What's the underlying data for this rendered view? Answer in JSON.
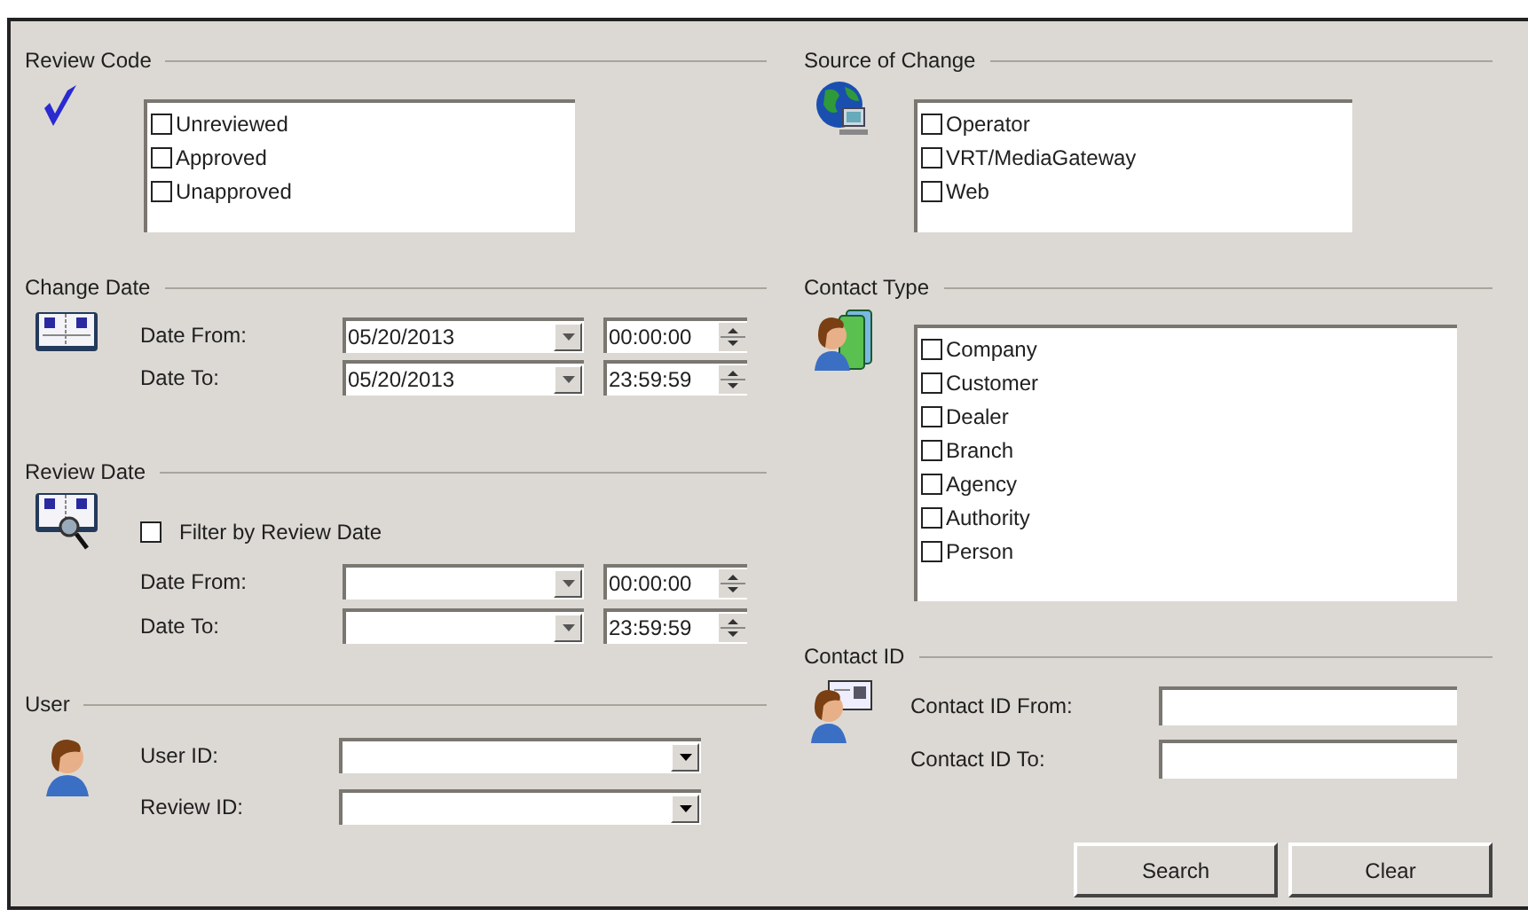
{
  "review_code": {
    "title": "Review Code",
    "options": [
      {
        "label": "Unreviewed",
        "checked": false
      },
      {
        "label": "Approved",
        "checked": false
      },
      {
        "label": "Unapproved",
        "checked": false
      }
    ]
  },
  "change_date": {
    "title": "Change Date",
    "rows": [
      {
        "label": "Date From:",
        "date": "05/20/2013",
        "time": "00:00:00"
      },
      {
        "label": "Date To:",
        "date": "05/20/2013",
        "time": "23:59:59"
      }
    ]
  },
  "review_date": {
    "title": "Review Date",
    "filter": {
      "label": "Filter by Review Date",
      "checked": false
    },
    "rows": [
      {
        "label": "Date From:",
        "time": "00:00:00"
      },
      {
        "label": "Date To:",
        "time": "23:59:59"
      }
    ]
  },
  "user": {
    "title": "User",
    "fields": [
      {
        "label": "User ID:"
      },
      {
        "label": "Review ID:"
      }
    ]
  },
  "source_of_change": {
    "title": "Source of Change",
    "options": [
      {
        "label": "Operator",
        "checked": false
      },
      {
        "label": "VRT/MediaGateway",
        "checked": false
      },
      {
        "label": "Web",
        "checked": false
      }
    ]
  },
  "contact_type": {
    "title": "Contact Type",
    "options": [
      {
        "label": "Company",
        "checked": false
      },
      {
        "label": "Customer",
        "checked": false
      },
      {
        "label": "Dealer",
        "checked": false
      },
      {
        "label": "Branch",
        "checked": false
      },
      {
        "label": "Agency",
        "checked": false
      },
      {
        "label": "Authority",
        "checked": false
      },
      {
        "label": "Person",
        "checked": false
      }
    ]
  },
  "contact_id": {
    "title": "Contact ID",
    "fields": [
      {
        "label": "Contact ID From:"
      },
      {
        "label": "Contact ID To:"
      }
    ]
  },
  "buttons": [
    "Search",
    "Clear"
  ]
}
